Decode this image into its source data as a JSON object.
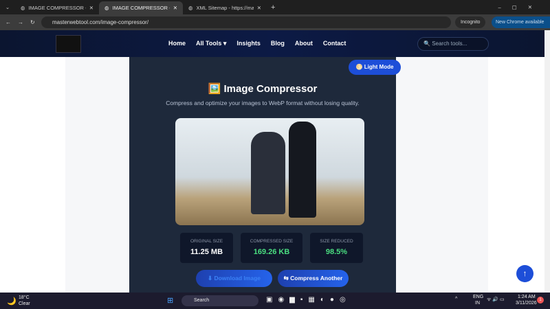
{
  "browser": {
    "tabs": [
      {
        "title": "IMAGE COMPRESSOR - https://"
      },
      {
        "title": "IMAGE COMPRESSOR - https://"
      },
      {
        "title": "XML Sitemap - https://masterw"
      }
    ],
    "url": "masterwebtool.com/image-compressor/",
    "incognito": "Incognito",
    "update": "New Chrome available"
  },
  "nav": {
    "links": [
      "Home",
      "All Tools ▾",
      "Insights",
      "Blog",
      "About",
      "Contact"
    ],
    "search_placeholder": "Search tools..."
  },
  "main": {
    "mode_button": "🌕 Light Mode",
    "title": "🖼️ Image Compressor",
    "subtitle": "Compress and optimize your images to WebP format without losing quality.",
    "stats": [
      {
        "label": "ORIGINAL SIZE",
        "value": "11.25 MB"
      },
      {
        "label": "COMPRESSED SIZE",
        "value": "169.26 KB"
      },
      {
        "label": "SIZE REDUCED",
        "value": "98.5%"
      }
    ],
    "download": "⬇ Download Image",
    "another": "⇆ Compress Another"
  },
  "taskbar": {
    "temp": "18°C",
    "weather": "Clear",
    "search": "Search",
    "lang1": "ENG",
    "lang2": "IN",
    "time": "1:24 AM",
    "date": "3/11/2026"
  },
  "colors": {
    "accent": "#2563eb",
    "green": "#4ade80",
    "card": "#1e293b"
  }
}
